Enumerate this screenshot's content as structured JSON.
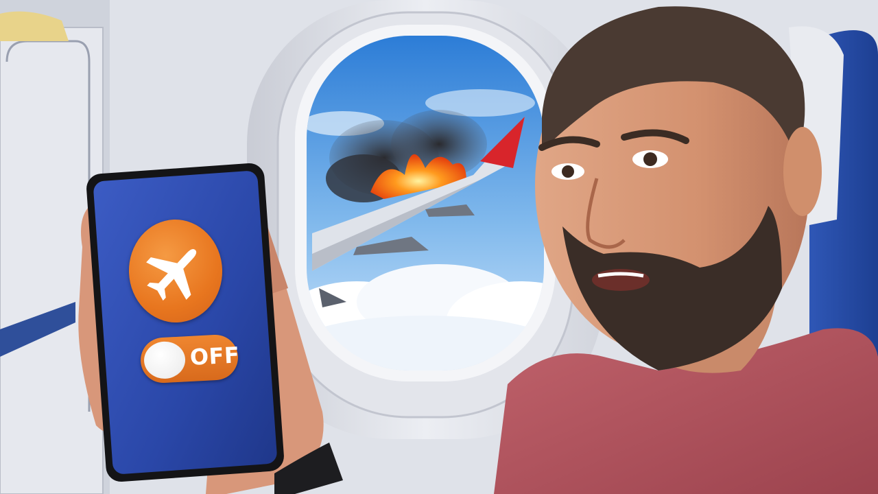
{
  "toggle": {
    "label": "OFF",
    "state": "off"
  },
  "icons": {
    "airplane": "airplane-icon"
  },
  "colors": {
    "accent": "#e8761f",
    "phone_screen": "#2f4fb0",
    "shirt": "#b85660",
    "sky": "#3e8ee0"
  }
}
